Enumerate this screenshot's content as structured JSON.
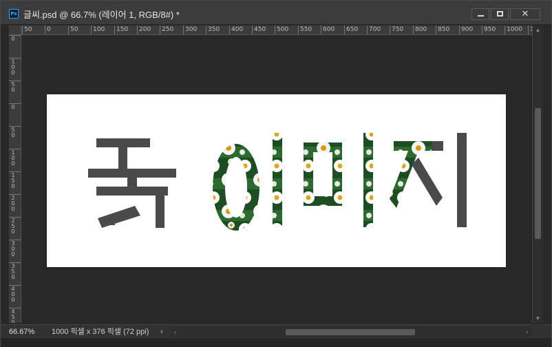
{
  "window": {
    "app_icon": "Ps",
    "title": "글씨.psd @ 66.7% (레이어 1, RGB/8#) *",
    "controls": {
      "minimize": "minimize-icon",
      "maximize": "maximize-icon",
      "close": "✕"
    }
  },
  "ruler_top": {
    "labels": [
      "50",
      "0",
      "50",
      "100",
      "150",
      "200",
      "250",
      "300",
      "350",
      "400",
      "450",
      "500",
      "550",
      "600",
      "650",
      "700",
      "750",
      "800",
      "850",
      "900",
      "950",
      "1000",
      "1"
    ]
  },
  "ruler_left": {
    "labels": [
      "0",
      "100",
      "50",
      "0",
      "50",
      "100",
      "150",
      "200",
      "250",
      "300",
      "350",
      "400",
      "450",
      "500"
    ]
  },
  "document": {
    "text_plain": "꽃",
    "text_image": "이미지",
    "text_plain_color": "#4a4a4a",
    "image_fill_colors": [
      "#1f4d23",
      "#ffffff",
      "#e0a21a"
    ]
  },
  "status": {
    "zoom": "66.67%",
    "doc_info": "1000 픽셀 x 376 픽셀 (72 ppi)",
    "info_arrow": "›"
  },
  "scroll": {
    "up_arrow": "▲",
    "down_arrow": "▼",
    "left_arrow": "‹",
    "right_arrow": "›"
  }
}
